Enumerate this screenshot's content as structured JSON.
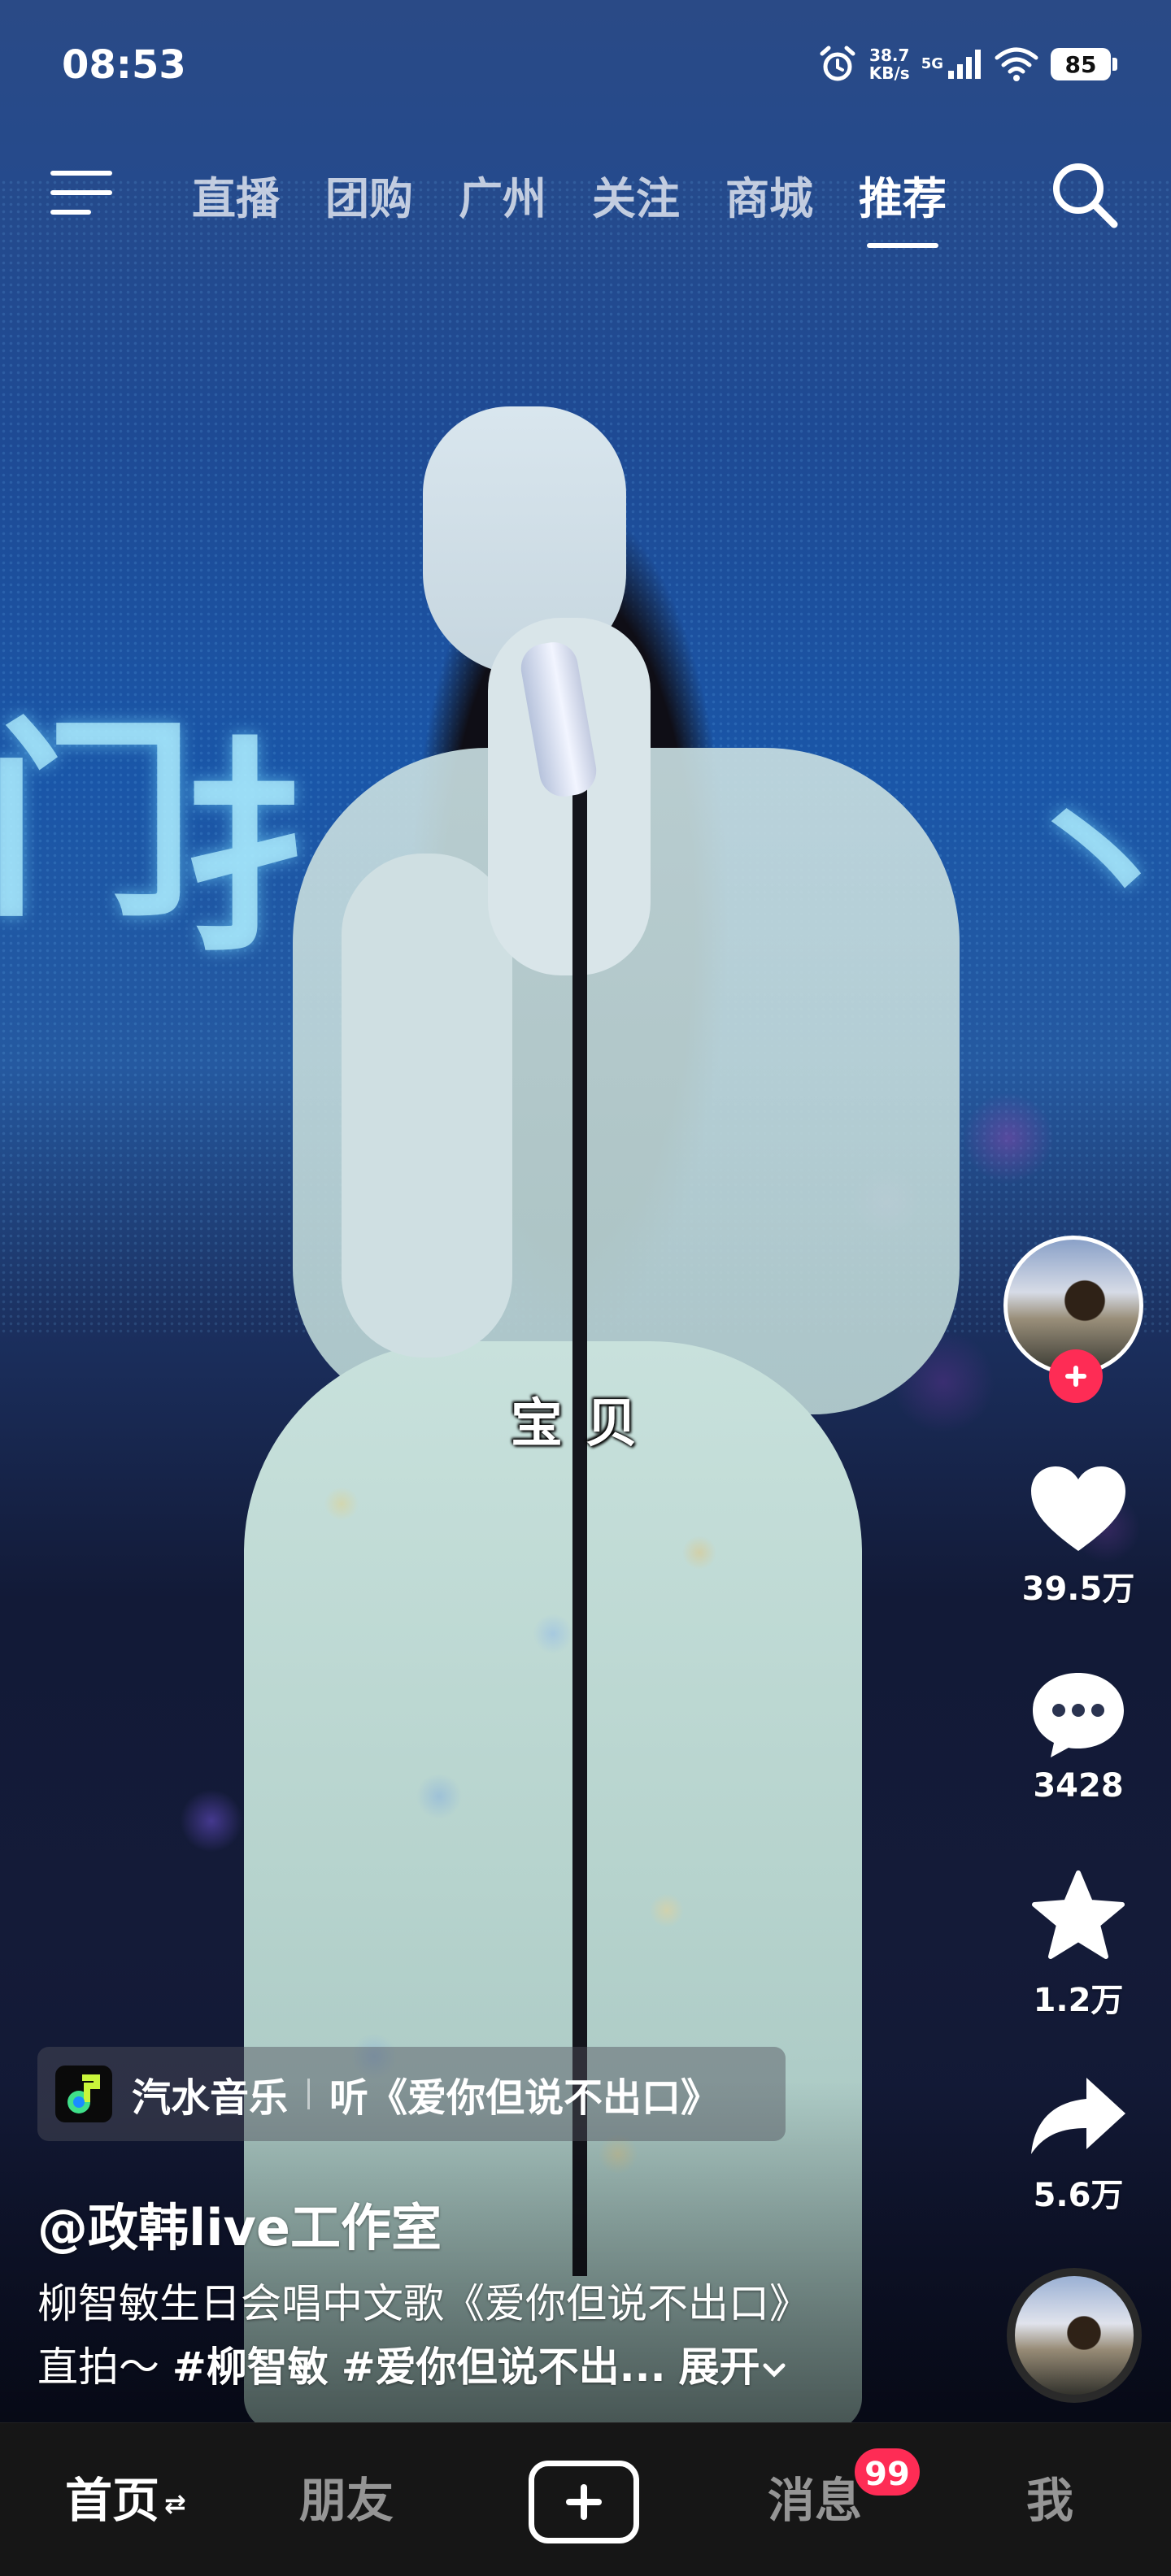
{
  "status_bar": {
    "time": "08:53",
    "net_speed_value": "38.7",
    "net_speed_unit": "KB/s",
    "network": "5G",
    "battery": "85",
    "icons": [
      "alarm-icon",
      "signal-icon",
      "wifi-icon",
      "battery-icon"
    ]
  },
  "top_nav": {
    "menu_icon": "hamburger-menu-icon",
    "tabs": [
      {
        "label": "直播",
        "active": false
      },
      {
        "label": "团购",
        "active": false
      },
      {
        "label": "广州",
        "active": false
      },
      {
        "label": "关注",
        "active": false
      },
      {
        "label": "商城",
        "active": false
      },
      {
        "label": "推荐",
        "active": true
      }
    ],
    "search_icon": "search-icon"
  },
  "video": {
    "subtitle": "宝贝"
  },
  "rail": {
    "follow_icon": "plus-icon",
    "like_count": "39.5万",
    "comment_count": "3428",
    "favorite_count": "1.2万",
    "share_count": "5.6万"
  },
  "music_chip": {
    "app_name": "汽水音乐",
    "song": "听《爱你但说不出口》"
  },
  "post": {
    "author": "@政韩live工作室",
    "desc_line1": "柳智敏生日会唱中文歌《爱你但说不出口》",
    "desc_line2_prefix": "直拍～ ",
    "hashtag1": "#柳智敏",
    "hashtag2": "#爱你但说不出...",
    "expand": "展开"
  },
  "bottom_nav": {
    "home": "首页",
    "friends": "朋友",
    "messages": "消息",
    "messages_badge": "99",
    "me": "我"
  },
  "colors": {
    "accent": "#fe2c55",
    "bottom_bar": "#161616"
  }
}
